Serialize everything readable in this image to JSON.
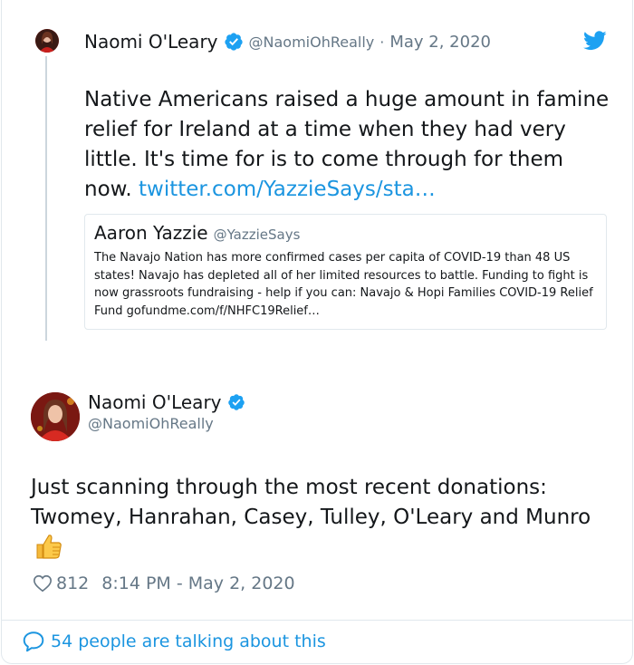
{
  "parent_tweet": {
    "author_name": "Naomi O'Leary",
    "author_handle": "@NaomiOhReally",
    "separator": "·",
    "date": "May 2, 2020",
    "text": "Native Americans raised a huge amount in famine relief for Ireland at a time when they had very little. It's time for is to come through for them now. ",
    "link_text": "twitter.com/YazzieSays/sta…",
    "quoted": {
      "author_name": "Aaron Yazzie",
      "author_handle": "@YazzieSays",
      "text": "The Navajo Nation has more confirmed cases per capita of COVID-19 than 48 US states! Navajo has depleted all of her limited resources to battle. Funding to fight is now grassroots fundraising - help if you can: Navajo & Hopi Families COVID-19 Relief Fund gofundme.com/f/NHFC19Relief…"
    }
  },
  "main_tweet": {
    "author_name": "Naomi O'Leary",
    "author_handle": "@NaomiOhReally",
    "text": "Just scanning through the most recent donations: Twomey, Hanrahan, Casey, Tulley, O'Leary and Munro ",
    "emoji": "thumbs-up",
    "likes": "812",
    "timestamp": "8:14 PM - May 2, 2020"
  },
  "footer": {
    "talking_text": "54 people are talking about this"
  },
  "colors": {
    "link": "#1b95e0",
    "secondary_text": "#657786",
    "border": "#e1e8ed",
    "verified": "#1da1f2"
  },
  "icons": [
    "verified-badge-icon",
    "twitter-bird-icon",
    "heart-icon",
    "speech-bubble-icon",
    "thumbs-up-icon"
  ]
}
